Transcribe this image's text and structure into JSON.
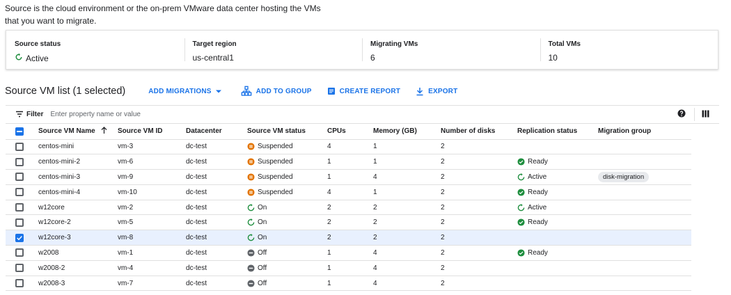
{
  "intro": {
    "line1": "Source is the cloud environment or the on-prem VMware data center hosting the VMs",
    "line2": "that you want to migrate."
  },
  "summary": {
    "source_status_label": "Source status",
    "source_status_value": "Active",
    "target_region_label": "Target region",
    "target_region_value": "us-central1",
    "migrating_label": "Migrating VMs",
    "migrating_value": "6",
    "total_label": "Total VMs",
    "total_value": "10"
  },
  "toolbar": {
    "title": "Source VM list (1 selected)",
    "add_migrations": "ADD MIGRATIONS",
    "add_to_group": "ADD TO GROUP",
    "create_report": "CREATE REPORT",
    "export": "EXPORT"
  },
  "filter": {
    "label": "Filter",
    "placeholder": "Enter property name or value"
  },
  "columns": {
    "name": "Source VM Name",
    "id": "Source VM ID",
    "datacenter": "Datacenter",
    "status": "Source VM status",
    "cpus": "CPUs",
    "memory": "Memory (GB)",
    "disks": "Number of disks",
    "replication": "Replication status",
    "group": "Migration group"
  },
  "colors": {
    "accent": "#1a73e8",
    "active_green": "#1e8e3e",
    "suspended_orange": "#e37400",
    "off_gray": "#5f6368"
  },
  "rows": [
    {
      "name": "centos-mini",
      "id": "vm-3",
      "datacenter": "dc-test",
      "status": "Suspended",
      "status_icon": "pause-circle-icon",
      "cpus": "4",
      "memory": "1",
      "disks": "2",
      "replication": "",
      "group": "",
      "selected": false
    },
    {
      "name": "centos-mini-2",
      "id": "vm-6",
      "datacenter": "dc-test",
      "status": "Suspended",
      "status_icon": "pause-circle-icon",
      "cpus": "1",
      "memory": "1",
      "disks": "2",
      "replication": "Ready",
      "group": "",
      "selected": false
    },
    {
      "name": "centos-mini-3",
      "id": "vm-9",
      "datacenter": "dc-test",
      "status": "Suspended",
      "status_icon": "pause-circle-icon",
      "cpus": "1",
      "memory": "4",
      "disks": "2",
      "replication": "Active",
      "group": "disk-migration",
      "selected": false
    },
    {
      "name": "centos-mini-4",
      "id": "vm-10",
      "datacenter": "dc-test",
      "status": "Suspended",
      "status_icon": "pause-circle-icon",
      "cpus": "4",
      "memory": "1",
      "disks": "2",
      "replication": "Ready",
      "group": "",
      "selected": false
    },
    {
      "name": "w12core",
      "id": "vm-2",
      "datacenter": "dc-test",
      "status": "On",
      "status_icon": "refresh-circle-icon",
      "cpus": "2",
      "memory": "2",
      "disks": "2",
      "replication": "Active",
      "group": "",
      "selected": false
    },
    {
      "name": "w12core-2",
      "id": "vm-5",
      "datacenter": "dc-test",
      "status": "On",
      "status_icon": "refresh-circle-icon",
      "cpus": "2",
      "memory": "2",
      "disks": "2",
      "replication": "Ready",
      "group": "",
      "selected": false
    },
    {
      "name": "w12core-3",
      "id": "vm-8",
      "datacenter": "dc-test",
      "status": "On",
      "status_icon": "refresh-circle-icon",
      "cpus": "2",
      "memory": "2",
      "disks": "2",
      "replication": "",
      "group": "",
      "selected": true
    },
    {
      "name": "w2008",
      "id": "vm-1",
      "datacenter": "dc-test",
      "status": "Off",
      "status_icon": "minus-circle-icon",
      "cpus": "1",
      "memory": "4",
      "disks": "2",
      "replication": "Ready",
      "group": "",
      "selected": false
    },
    {
      "name": "w2008-2",
      "id": "vm-4",
      "datacenter": "dc-test",
      "status": "Off",
      "status_icon": "minus-circle-icon",
      "cpus": "1",
      "memory": "4",
      "disks": "2",
      "replication": "",
      "group": "",
      "selected": false
    },
    {
      "name": "w2008-3",
      "id": "vm-7",
      "datacenter": "dc-test",
      "status": "Off",
      "status_icon": "minus-circle-icon",
      "cpus": "1",
      "memory": "4",
      "disks": "2",
      "replication": "",
      "group": "",
      "selected": false
    }
  ]
}
